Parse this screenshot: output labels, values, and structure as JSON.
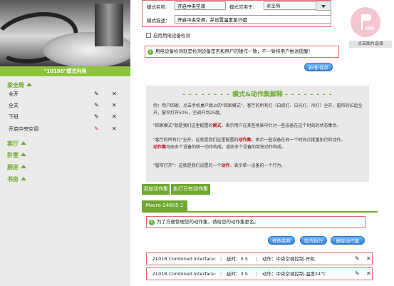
{
  "left": {
    "list_title": "\"10188\"模式列表",
    "rooms": [
      {
        "label": "家全局"
      },
      {
        "label": "客厅"
      },
      {
        "label": "卧室"
      },
      {
        "label": "厨房"
      },
      {
        "label": "书房"
      }
    ],
    "modes": [
      {
        "label": "全开"
      },
      {
        "label": "全关"
      },
      {
        "label": "下班"
      },
      {
        "label": "开启中央空调"
      }
    ],
    "edit_icon": "pencil-icon",
    "delete_icon": "close-icon"
  },
  "form": {
    "name_label": "模式名称:",
    "name_value": "开启中央空调",
    "apply_label": "模式应用于：",
    "apply_value": "家全局",
    "desc_label": "模式描述：",
    "desc_value": "开启中央空调，并设置温度至25度",
    "checkbox_label": "启用用电设备检测",
    "warning": "用电设备检测就是检测设备是否和用户的操作一致，不一致将用户推送提醒！",
    "save_button": "新增/保存"
  },
  "help": {
    "title": "模式&动作集解释",
    "dashes": "- - - - - - - -",
    "p1": "例：用户回家，点击手机桌户跳上的\"回家模式\"，客厅的所有灯（白织灯、日光灯、吊灯）全开，窗帘的拉起全开，窗帘打开50%，空调开到25度。",
    "p2a": "\"回家模式\"就是我们这里配置的",
    "p2b": "模式",
    "p2c": "，表示用户在某些场景中针对一些设备在这个时刻的状态集合。",
    "p3a": "\"客厅的所有灯\"全开，这就是我们这里配置的",
    "p3b": "动作集",
    "p3c": "，表示一些设备在同一个时间点批量执行的动作。",
    "p3d": "动作集",
    "p3e": "可由多个设备的统一动作构成，或由多个设备的单独动作构成。",
    "p4a": "\"窗帘打开\"：这就是我们设置的一个",
    "p4b": "动作",
    "p4c": "，表示单一设备的一个行为。"
  },
  "tabs": {
    "add_action_set": "添加动作集",
    "execute_existing": "执行已有动作集",
    "macro": "Macro-24605-1"
  },
  "macro": {
    "warning": "为了方便管理您的动作集，请给您的动作集更名。",
    "rename_button": "修改名称",
    "cancel_button": "取消执行",
    "delete_button": "删除动作集",
    "actions": [
      {
        "device": "ZL01B Combined Interface:",
        "delay": "延时：0 S",
        "action": "动作：中央空调控制-开机"
      },
      {
        "device": "ZL01B Combined Interface:",
        "delay": "延时：3 S",
        "action": "动作：中央空调控制-温度24℃"
      }
    ]
  },
  "right": {
    "pick_label": "点击图片选择",
    "flag_text": "ON"
  }
}
